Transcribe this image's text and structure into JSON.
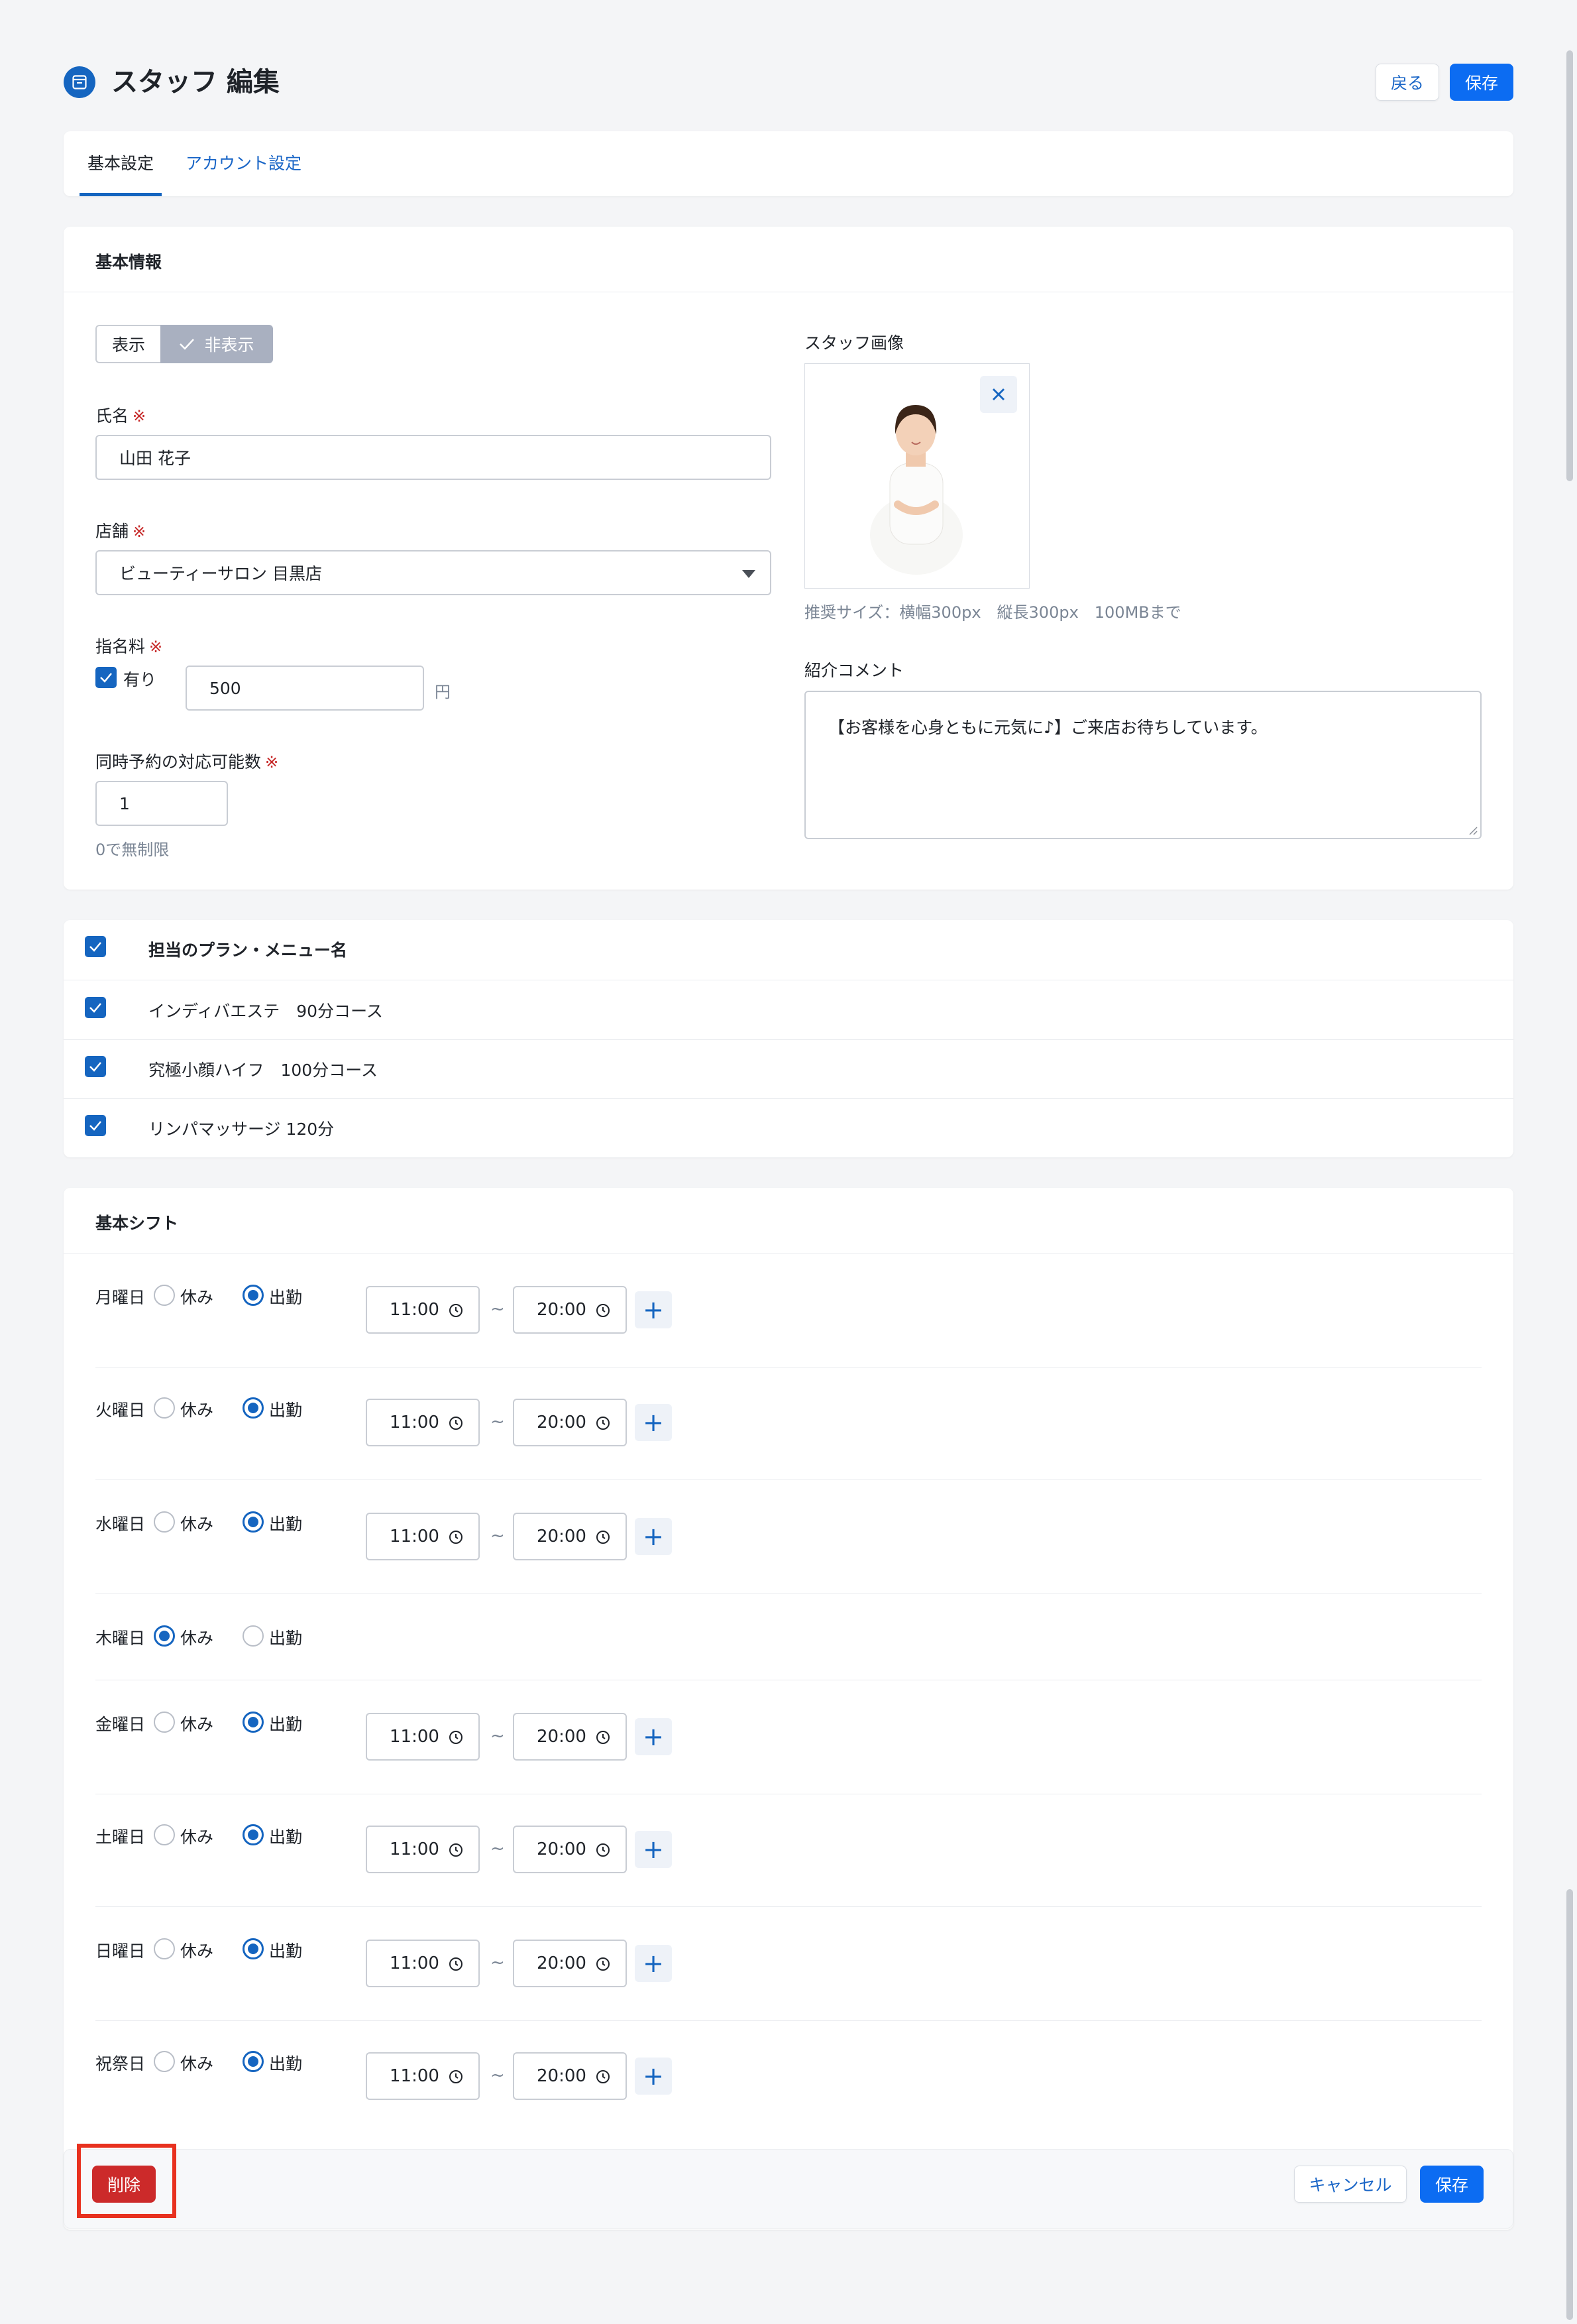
{
  "header": {
    "title": "スタッフ 編集",
    "back_label": "戻る",
    "save_label": "保存"
  },
  "tabs": [
    {
      "label": "基本設定",
      "active": true
    },
    {
      "label": "アカウント設定",
      "active": false
    }
  ],
  "basic_info": {
    "section_title": "基本情報",
    "visibility": {
      "show_label": "表示",
      "hide_label": "非表示",
      "selected": "非表示"
    },
    "name": {
      "label": "氏名",
      "required_mark": "※",
      "value": "山田 花子"
    },
    "store": {
      "label": "店舗",
      "required_mark": "※",
      "value": "ビューティーサロン 目黒店"
    },
    "nomination_fee": {
      "label": "指名料",
      "required_mark": "※",
      "checkbox_label": "有り",
      "checked": true,
      "value": "500",
      "unit": "円"
    },
    "concurrent": {
      "label": "同時予約の対応可能数",
      "required_mark": "※",
      "value": "1",
      "help": "0で無制限"
    },
    "image": {
      "label": "スタッフ画像",
      "hint": "推奨サイズ：横幅300px　縦長300px　100MBまで"
    },
    "comment": {
      "label": "紹介コメント",
      "value": "【お客様を心身ともに元気に♪】ご来店お待ちしています。"
    }
  },
  "plans": {
    "header_label": "担当のプラン・メニュー名",
    "items": [
      {
        "label": "インディバエステ　90分コース",
        "checked": true
      },
      {
        "label": "究極小顔ハイフ　100分コース",
        "checked": true
      },
      {
        "label": "リンパマッサージ 120分",
        "checked": true
      }
    ]
  },
  "shift": {
    "section_title": "基本シフト",
    "off_label": "休み",
    "on_label": "出勤",
    "tilde": "~",
    "plus": "+",
    "days": [
      {
        "day": "月曜日",
        "status": "on",
        "start": "11:00",
        "end": "20:00"
      },
      {
        "day": "火曜日",
        "status": "on",
        "start": "11:00",
        "end": "20:00"
      },
      {
        "day": "水曜日",
        "status": "on",
        "start": "11:00",
        "end": "20:00"
      },
      {
        "day": "木曜日",
        "status": "off",
        "start": "",
        "end": ""
      },
      {
        "day": "金曜日",
        "status": "on",
        "start": "11:00",
        "end": "20:00"
      },
      {
        "day": "土曜日",
        "status": "on",
        "start": "11:00",
        "end": "20:00"
      },
      {
        "day": "日曜日",
        "status": "on",
        "start": "11:00",
        "end": "20:00"
      },
      {
        "day": "祝祭日",
        "status": "on",
        "start": "11:00",
        "end": "20:00"
      }
    ]
  },
  "footer": {
    "delete_label": "削除",
    "cancel_label": "キャンセル",
    "save_label": "保存"
  },
  "colors": {
    "primary": "#0c6cf2",
    "accent": "#1565c0",
    "danger": "#cc2a2a",
    "highlight": "#e8311f"
  }
}
